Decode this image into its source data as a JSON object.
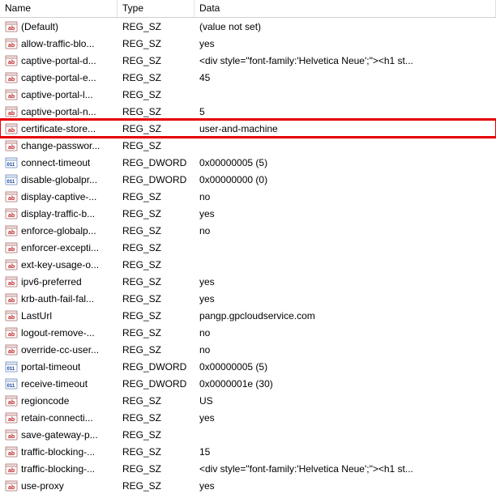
{
  "columns": {
    "name": "Name",
    "type": "Type",
    "data": "Data"
  },
  "icon_kind": {
    "sz": "string-icon",
    "dw": "dword-icon"
  },
  "rows": [
    {
      "icon": "sz",
      "name": "(Default)",
      "type": "REG_SZ",
      "data": "(value not set)"
    },
    {
      "icon": "sz",
      "name": "allow-traffic-blo...",
      "type": "REG_SZ",
      "data": "yes"
    },
    {
      "icon": "sz",
      "name": "captive-portal-d...",
      "type": "REG_SZ",
      "data": "<div style=\"font-family:'Helvetica Neue';\"><h1 st..."
    },
    {
      "icon": "sz",
      "name": "captive-portal-e...",
      "type": "REG_SZ",
      "data": "45"
    },
    {
      "icon": "sz",
      "name": "captive-portal-l...",
      "type": "REG_SZ",
      "data": ""
    },
    {
      "icon": "sz",
      "name": "captive-portal-n...",
      "type": "REG_SZ",
      "data": "5"
    },
    {
      "icon": "sz",
      "name": "certificate-store...",
      "type": "REG_SZ",
      "data": "user-and-machine",
      "highlighted": true
    },
    {
      "icon": "sz",
      "name": "change-passwor...",
      "type": "REG_SZ",
      "data": ""
    },
    {
      "icon": "dw",
      "name": "connect-timeout",
      "type": "REG_DWORD",
      "data": "0x00000005 (5)"
    },
    {
      "icon": "dw",
      "name": "disable-globalpr...",
      "type": "REG_DWORD",
      "data": "0x00000000 (0)"
    },
    {
      "icon": "sz",
      "name": "display-captive-...",
      "type": "REG_SZ",
      "data": "no"
    },
    {
      "icon": "sz",
      "name": "display-traffic-b...",
      "type": "REG_SZ",
      "data": "yes"
    },
    {
      "icon": "sz",
      "name": "enforce-globalp...",
      "type": "REG_SZ",
      "data": "no"
    },
    {
      "icon": "sz",
      "name": "enforcer-excepti...",
      "type": "REG_SZ",
      "data": ""
    },
    {
      "icon": "sz",
      "name": "ext-key-usage-o...",
      "type": "REG_SZ",
      "data": ""
    },
    {
      "icon": "sz",
      "name": "ipv6-preferred",
      "type": "REG_SZ",
      "data": "yes"
    },
    {
      "icon": "sz",
      "name": "krb-auth-fail-fal...",
      "type": "REG_SZ",
      "data": "yes"
    },
    {
      "icon": "sz",
      "name": "LastUrl",
      "type": "REG_SZ",
      "data": "pangp.gpcloudservice.com"
    },
    {
      "icon": "sz",
      "name": "logout-remove-...",
      "type": "REG_SZ",
      "data": "no"
    },
    {
      "icon": "sz",
      "name": "override-cc-user...",
      "type": "REG_SZ",
      "data": "no"
    },
    {
      "icon": "dw",
      "name": "portal-timeout",
      "type": "REG_DWORD",
      "data": "0x00000005 (5)"
    },
    {
      "icon": "dw",
      "name": "receive-timeout",
      "type": "REG_DWORD",
      "data": "0x0000001e (30)"
    },
    {
      "icon": "sz",
      "name": "regioncode",
      "type": "REG_SZ",
      "data": "US"
    },
    {
      "icon": "sz",
      "name": "retain-connecti...",
      "type": "REG_SZ",
      "data": "yes"
    },
    {
      "icon": "sz",
      "name": "save-gateway-p...",
      "type": "REG_SZ",
      "data": ""
    },
    {
      "icon": "sz",
      "name": "traffic-blocking-...",
      "type": "REG_SZ",
      "data": "15"
    },
    {
      "icon": "sz",
      "name": "traffic-blocking-...",
      "type": "REG_SZ",
      "data": "<div style=\"font-family:'Helvetica Neue';\"><h1 st..."
    },
    {
      "icon": "sz",
      "name": "use-proxy",
      "type": "REG_SZ",
      "data": "yes"
    }
  ]
}
